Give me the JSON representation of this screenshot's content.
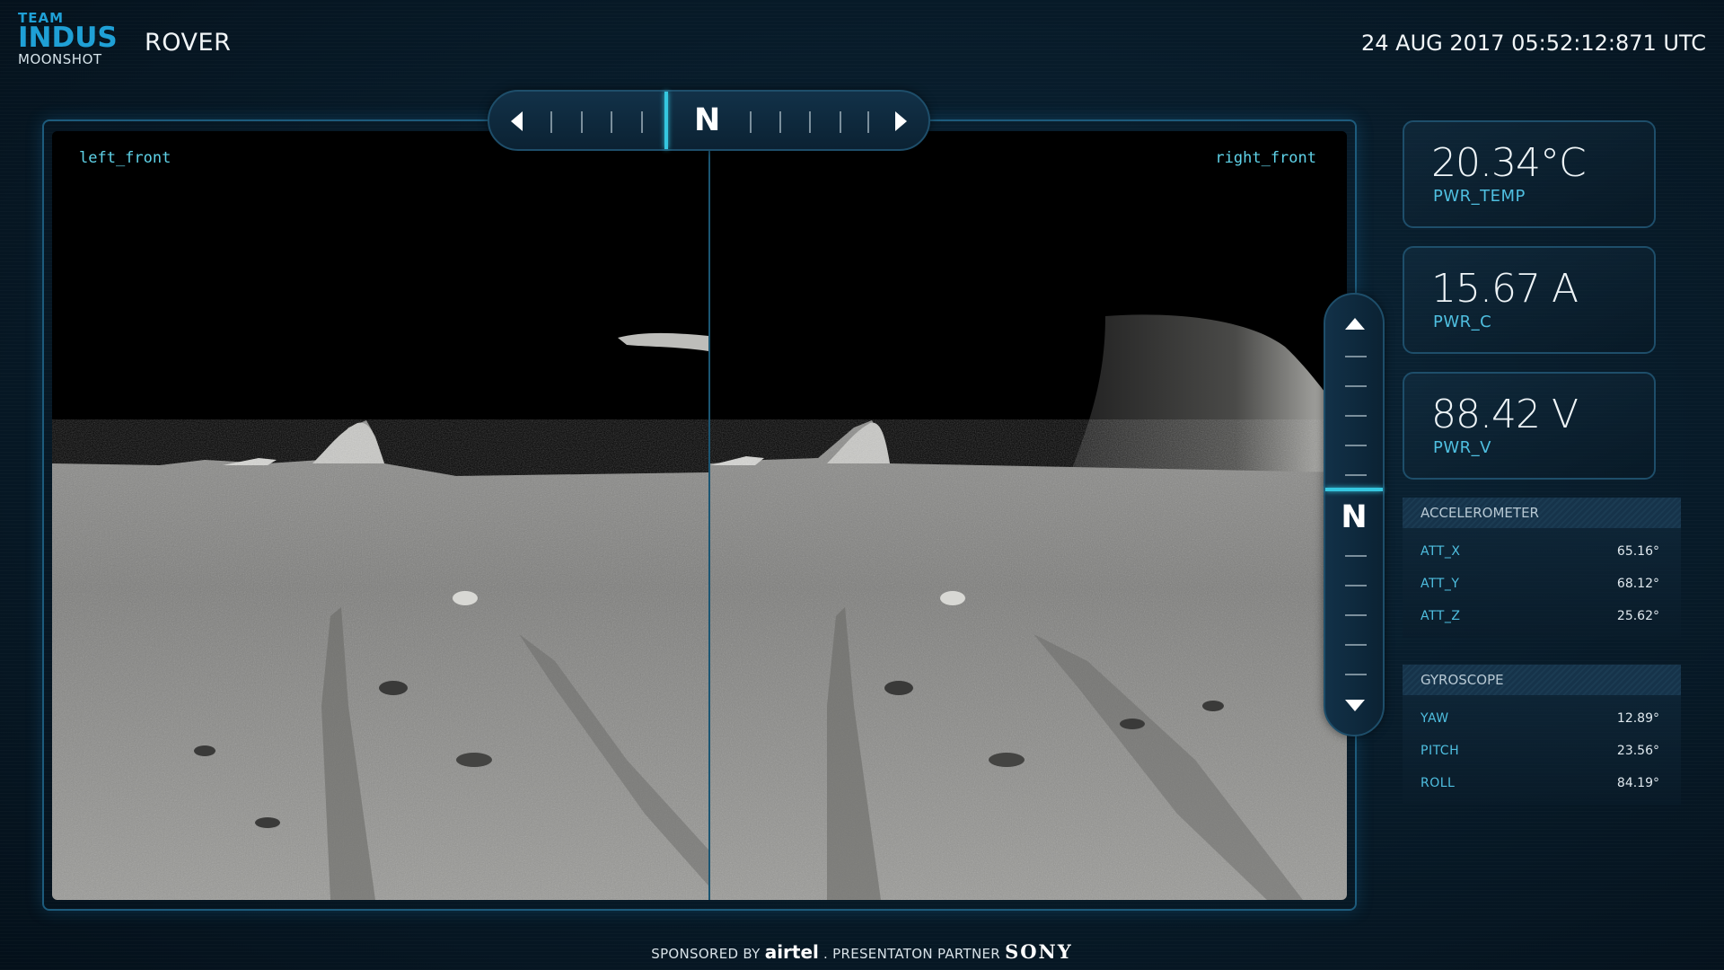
{
  "header": {
    "logo_team": "TEAM",
    "logo_name": "INDUS",
    "logo_sub": "MOONSHOT",
    "title": "ROVER",
    "timestamp": "24 AUG 2017 05:52:12:871 UTC"
  },
  "cameras": {
    "left_label": "left_front",
    "right_label": "right_front"
  },
  "compass": {
    "horizontal_heading": "N",
    "vertical_heading": "N"
  },
  "metrics": [
    {
      "value": "20.34°C",
      "label": "PWR_TEMP"
    },
    {
      "value": "15.67 A",
      "label": "PWR_C"
    },
    {
      "value": "88.42 V",
      "label": "PWR_V"
    }
  ],
  "accelerometer": {
    "title": "ACCELEROMETER",
    "rows": [
      {
        "key": "ATT_X",
        "value": "65.16°"
      },
      {
        "key": "ATT_Y",
        "value": "68.12°"
      },
      {
        "key": "ATT_Z",
        "value": "25.62°"
      }
    ]
  },
  "gyroscope": {
    "title": "GYROSCOPE",
    "rows": [
      {
        "key": "YAW",
        "value": "12.89°"
      },
      {
        "key": "PITCH",
        "value": "23.56°"
      },
      {
        "key": "ROLL",
        "value": "84.19°"
      }
    ]
  },
  "footer": {
    "sponsored_by": "SPONSORED BY",
    "sponsor": "airtel",
    "partner_text": ". PRESENTATON PARTNER",
    "partner": "SONY"
  },
  "colors": {
    "accent": "#35c7e0",
    "label": "#4fbfe0",
    "brand": "#1fa0d6",
    "border": "#1e4e6a"
  }
}
